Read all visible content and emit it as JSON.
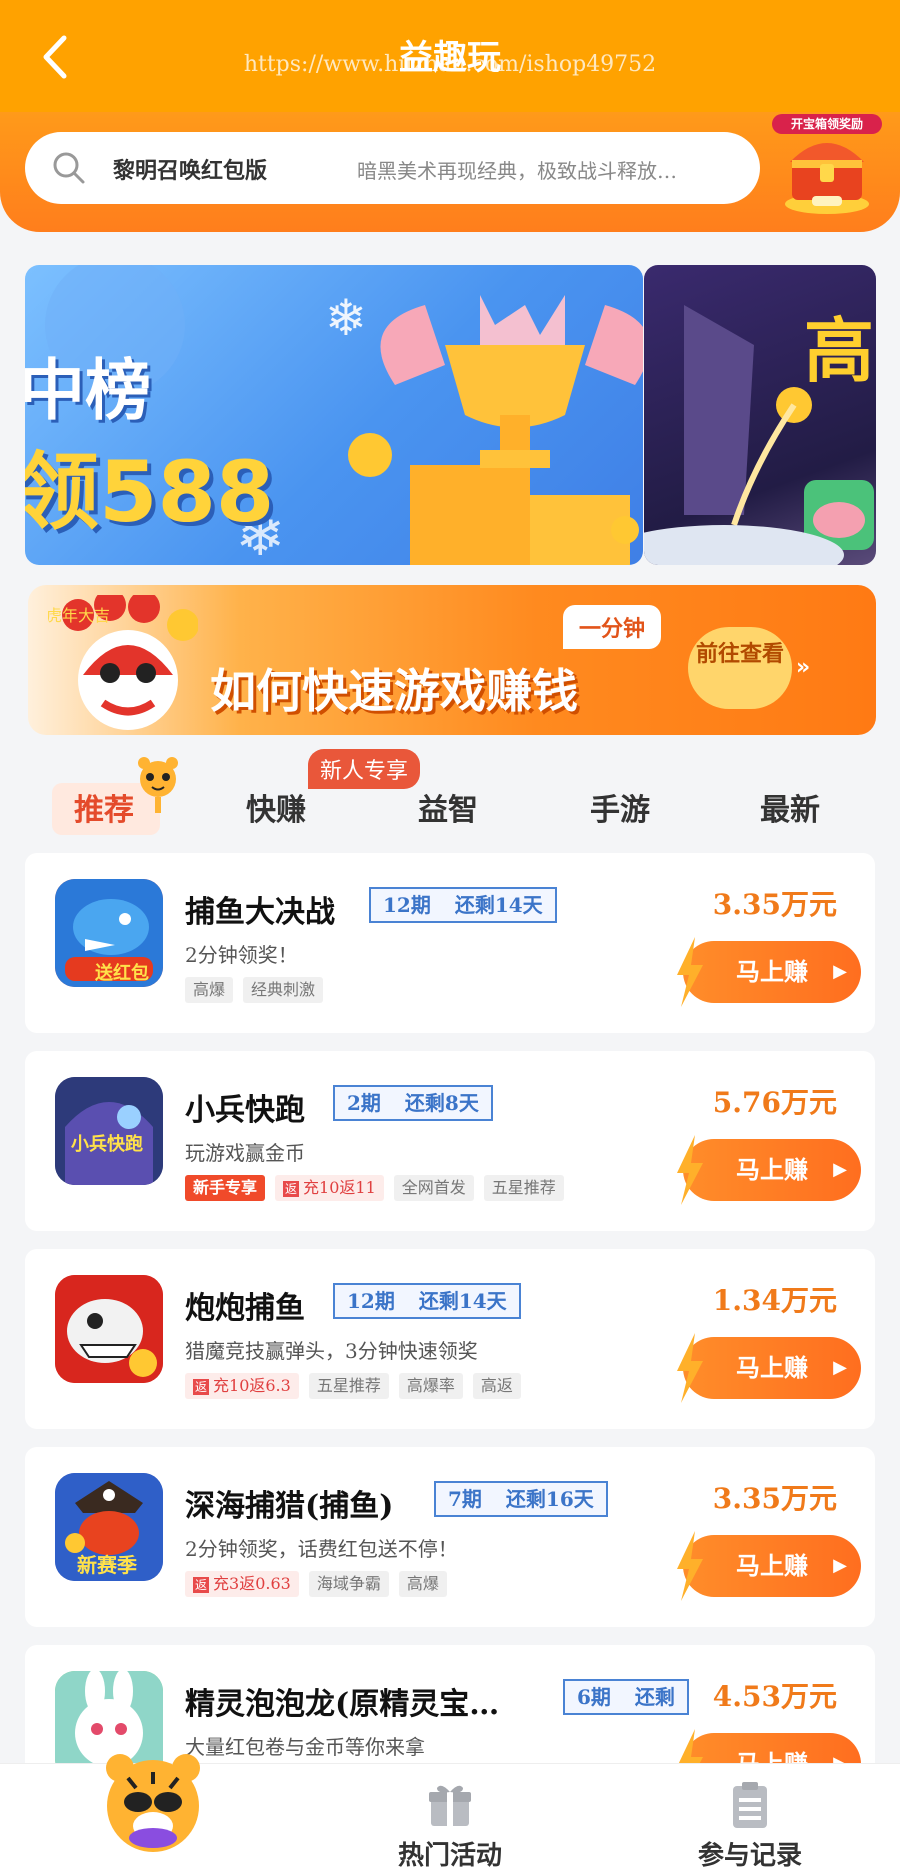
{
  "header": {
    "title": "益趣玩",
    "watermark": "https://www.huzhan.com/ishop49752"
  },
  "search": {
    "game": "黎明召唤红包版",
    "desc": "暗黑美术再现经典，极致战斗释放…",
    "treasure_label": "开宝箱领奖励"
  },
  "banners": {
    "main_line1": "中榜",
    "main_line2": "领588",
    "side_text": "高"
  },
  "promo": {
    "title": "如何快速游戏赚钱",
    "tag": "一分钟",
    "button": "前往查看",
    "button_arrow": "»",
    "lion_text": "虎年大吉"
  },
  "tabs": {
    "items": [
      "推荐",
      "快赚",
      "益智",
      "手游",
      "最新"
    ],
    "active": "推荐",
    "new_badge": "新人专享"
  },
  "games": [
    {
      "name": "捕鱼大决战",
      "period": "12期",
      "remaining": "还剩14天",
      "desc": "2分钟领奖！",
      "tags": [
        "高爆",
        "经典刺激"
      ],
      "amount": "3.35万元",
      "button": "马上赚",
      "icon_text": "送红包",
      "icon_color": "#e53a1f"
    },
    {
      "name": "小兵快跑",
      "period": "2期",
      "remaining": "还剩8天",
      "desc": "玩游戏赢金币",
      "new_tag": "新手专享",
      "rebate_mark": "返",
      "rebate": "充10返11",
      "tags": [
        "全网首发",
        "五星推荐"
      ],
      "amount": "5.76万元",
      "button": "马上赚",
      "icon_text": "小兵快跑",
      "icon_color": "#2d3a7a"
    },
    {
      "name": "炮炮捕鱼",
      "period": "12期",
      "remaining": "还剩14天",
      "desc": "猎魔竞技赢弹头，3分钟快速领奖",
      "rebate_mark": "返",
      "rebate": "充10返6.3",
      "tags": [
        "五星推荐",
        "高爆率",
        "高返"
      ],
      "amount": "1.34万元",
      "button": "马上赚",
      "icon_text": "",
      "icon_color": "#d8261e"
    },
    {
      "name": "深海捕猎(捕鱼)",
      "period": "7期",
      "remaining": "还剩16天",
      "desc": "2分钟领奖，话费红包送不停！",
      "rebate_mark": "返",
      "rebate": "充3返0.63",
      "tags": [
        "海域争霸",
        "高爆"
      ],
      "amount": "3.35万元",
      "button": "马上赚",
      "icon_text": "新赛季",
      "icon_color": "#3a4fb0"
    },
    {
      "name": "精灵泡泡龙(原精灵宝…",
      "period": "6期",
      "remaining": "还剩",
      "desc": "大量红包卷与金币等你来拿",
      "tags": [],
      "amount": "4.53万元",
      "button": "马上赚",
      "icon_text": "",
      "icon_color": "#6fcf6a"
    }
  ],
  "bottom_nav": {
    "items": [
      "",
      "热门活动",
      "参与记录"
    ]
  },
  "colors": {
    "brand_orange": "#ffa200",
    "accent": "#ff7a1c",
    "period_blue": "#3b74c8"
  }
}
